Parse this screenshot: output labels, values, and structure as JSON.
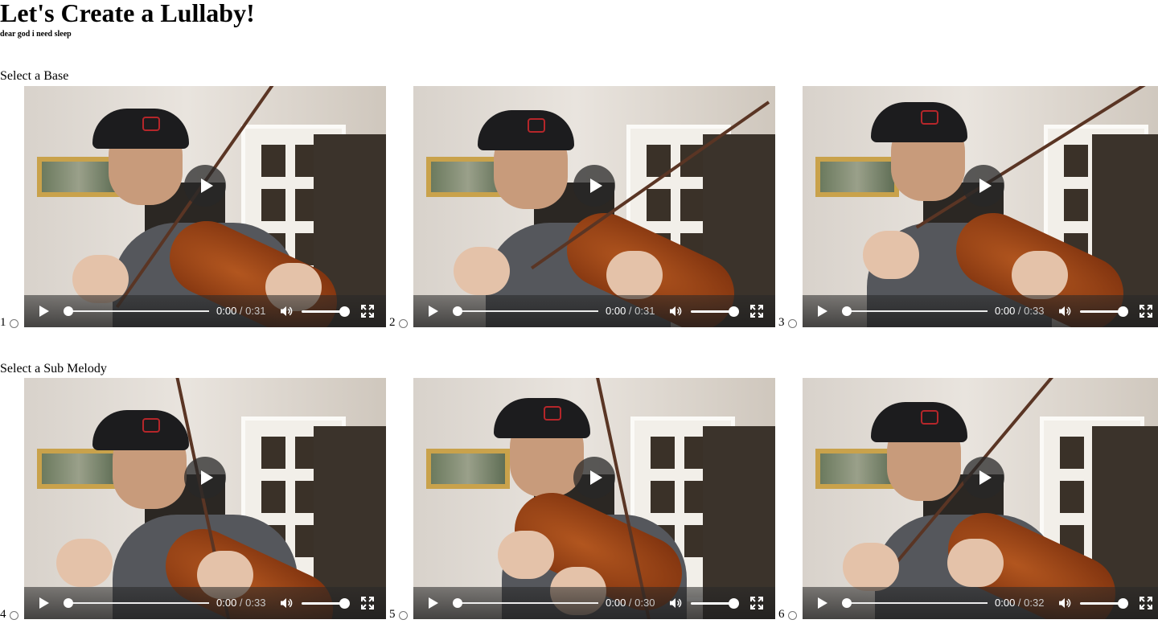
{
  "header": {
    "title": "Let's Create a Lullaby!",
    "subtitle": "dear god i need sleep"
  },
  "sections": [
    {
      "label": "Select a Base",
      "options": [
        {
          "number": "1",
          "current_time": "0:00",
          "separator": " / ",
          "duration": "0:31",
          "progress": 0,
          "volume": 1
        },
        {
          "number": "2",
          "current_time": "0:00",
          "separator": " / ",
          "duration": "0:31",
          "progress": 0,
          "volume": 1
        },
        {
          "number": "3",
          "current_time": "0:00",
          "separator": " / ",
          "duration": "0:33",
          "progress": 0,
          "volume": 1
        }
      ]
    },
    {
      "label": "Select a Sub Melody",
      "options": [
        {
          "number": "4",
          "current_time": "0:00",
          "separator": " / ",
          "duration": "0:33",
          "progress": 0,
          "volume": 1
        },
        {
          "number": "5",
          "current_time": "0:00",
          "separator": " / ",
          "duration": "0:30",
          "progress": 0,
          "volume": 1
        },
        {
          "number": "6",
          "current_time": "0:00",
          "separator": " / ",
          "duration": "0:32",
          "progress": 0,
          "volume": 1
        }
      ]
    }
  ],
  "icons": {
    "overlay_play": "play-icon",
    "control_play": "play-icon",
    "volume": "volume-icon",
    "fullscreen": "fullscreen-icon"
  }
}
